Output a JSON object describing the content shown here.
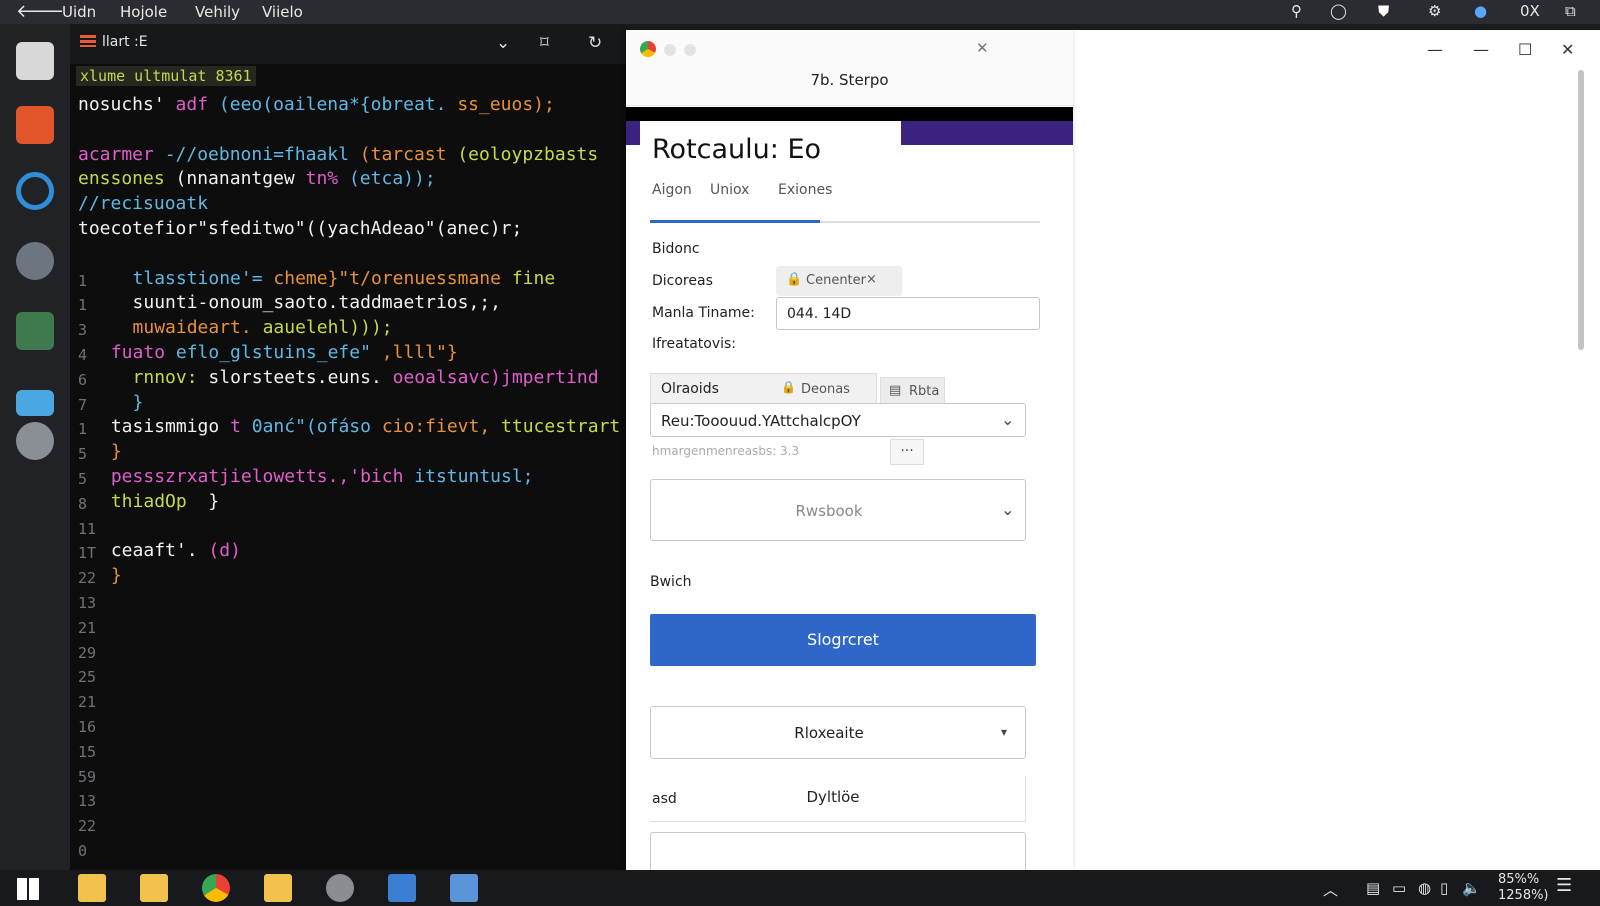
{
  "topbar": {
    "menus": [
      "Uidn",
      "Hojole",
      "Vehily",
      "Viielo"
    ],
    "right_label": "0X"
  },
  "editor": {
    "tab_title": "llart :E",
    "status_line": "xlume ultmulat 8361",
    "code_lines": [
      {
        "num": "",
        "text": "nosuchs' adf (eeo(oailena*{obreat. ss_euos);"
      },
      {
        "num": "",
        "text": ""
      },
      {
        "num": "",
        "text": "acarmer -//oebnoni=fhaakl (tarcast (eoloypzbasts"
      },
      {
        "num": "",
        "text": "enssones (nnanantgew tn% (etca));"
      },
      {
        "num": "",
        "text": "//recisuoatk"
      },
      {
        "num": "",
        "text": "toecotefior\"sfeditwo\"((yachAdeao\"(anec)r;"
      },
      {
        "num": "",
        "text": ""
      },
      {
        "num": "1",
        "text": "   tlasstione'= cheme}\"t/orenuessmane fine"
      },
      {
        "num": "1",
        "text": "   suunti-onoum_saoto.taddmaetrios,;,"
      },
      {
        "num": "3",
        "text": "   muwaideart. aauelehl)));"
      },
      {
        "num": "4",
        "text": " fuato eflo_glstuins_efe\" ,llll\"}"
      },
      {
        "num": "6",
        "text": "   rnnov: slorsteets.euns. oeoalsavc)jmpertind"
      },
      {
        "num": "7",
        "text": "   }"
      },
      {
        "num": "1",
        "text": " tasismmigo t 0anć\"(ofáso cio:fievt, ttucestrart"
      },
      {
        "num": "5",
        "text": " }"
      },
      {
        "num": "5",
        "text": " pessszrxatjielowetts.,'bich itstuntusl;"
      },
      {
        "num": "8",
        "text": " thiadOp  }"
      },
      {
        "num": "11",
        "text": ""
      },
      {
        "num": "1T",
        "text": " ceaaft'. (d)"
      },
      {
        "num": "22",
        "text": " }"
      },
      {
        "num": "13",
        "text": ""
      },
      {
        "num": "21",
        "text": ""
      },
      {
        "num": "29",
        "text": ""
      },
      {
        "num": "25",
        "text": ""
      },
      {
        "num": "21",
        "text": ""
      },
      {
        "num": "16",
        "text": ""
      },
      {
        "num": "15",
        "text": ""
      },
      {
        "num": "59",
        "text": ""
      },
      {
        "num": "13",
        "text": ""
      },
      {
        "num": "22",
        "text": ""
      },
      {
        "num": "0",
        "text": ""
      }
    ]
  },
  "popup": {
    "title": "7b. Sterpo",
    "heading": "Rotcaulu:  Eo",
    "tabs": [
      "Aigon",
      "Uniox",
      "Exiones"
    ],
    "section_label": "Bidonc",
    "row1_label": "Dicoreas",
    "row1_chip": "Cenenter",
    "row2_label": "Manla Tiname:",
    "row2_value": "044. 14D",
    "row3_label": "Ifreatatovis:",
    "subtabs": [
      "Olraoids",
      "Deonas",
      "Rbta"
    ],
    "select_value": "Reu:Tooouud.YAttchalcpOY",
    "helper_text": "hmargenmenreasbs: 3.3",
    "dropdown1": "Rwsbook",
    "section2_label": "Bwich",
    "primary_button": "Slogrcret",
    "dropdown2": "Rloxeaite",
    "last_label": "asd",
    "last_value": "Dyltlöe"
  },
  "tray": {
    "clock_top": "85%%",
    "clock_bottom": "1258%)"
  }
}
